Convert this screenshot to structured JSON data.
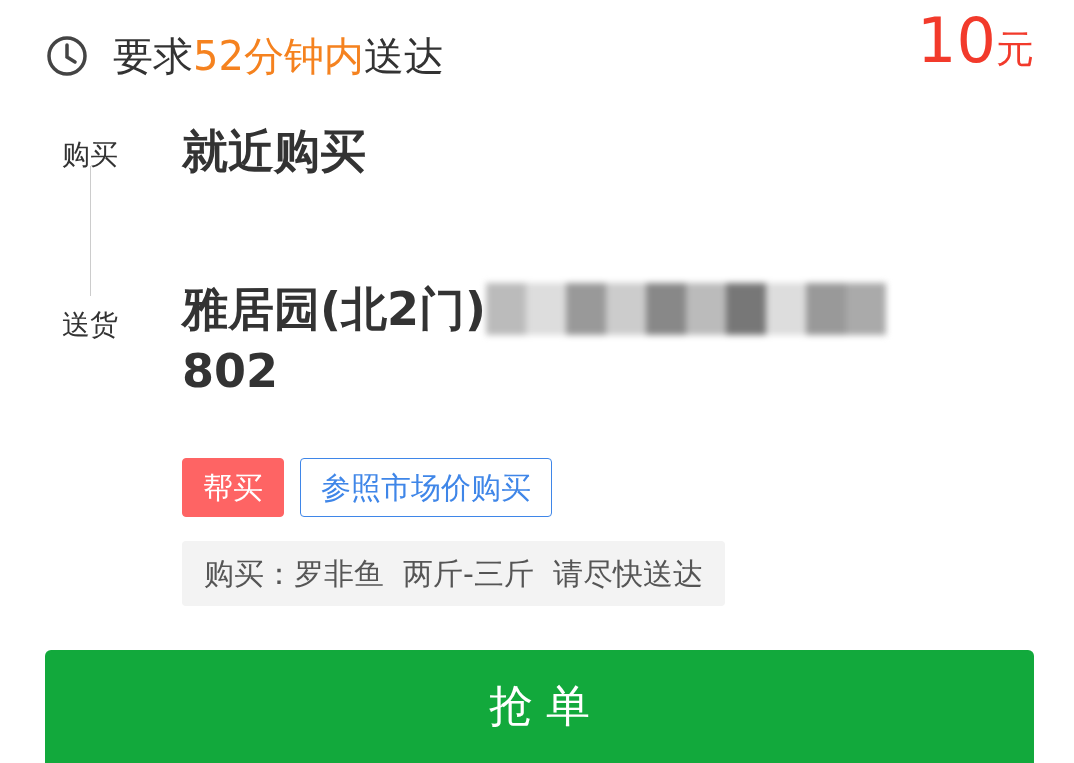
{
  "deadline": {
    "prefix": "要求",
    "highlight": "52分钟内",
    "suffix": "送达"
  },
  "price": {
    "amount": "10",
    "unit": "元"
  },
  "route": [
    {
      "label": "购买",
      "lines": [
        "就近购买"
      ]
    },
    {
      "label": "送货",
      "lines": [
        "雅居园(北2门)",
        "802"
      ],
      "redacted": true
    }
  ],
  "tags": [
    {
      "text": "帮买",
      "kind": "filled"
    },
    {
      "text": "参照市场价购买",
      "kind": "outline"
    }
  ],
  "note": "购买：罗非鱼  两斤-三斤  请尽快送达",
  "action_button": "抢 单"
}
